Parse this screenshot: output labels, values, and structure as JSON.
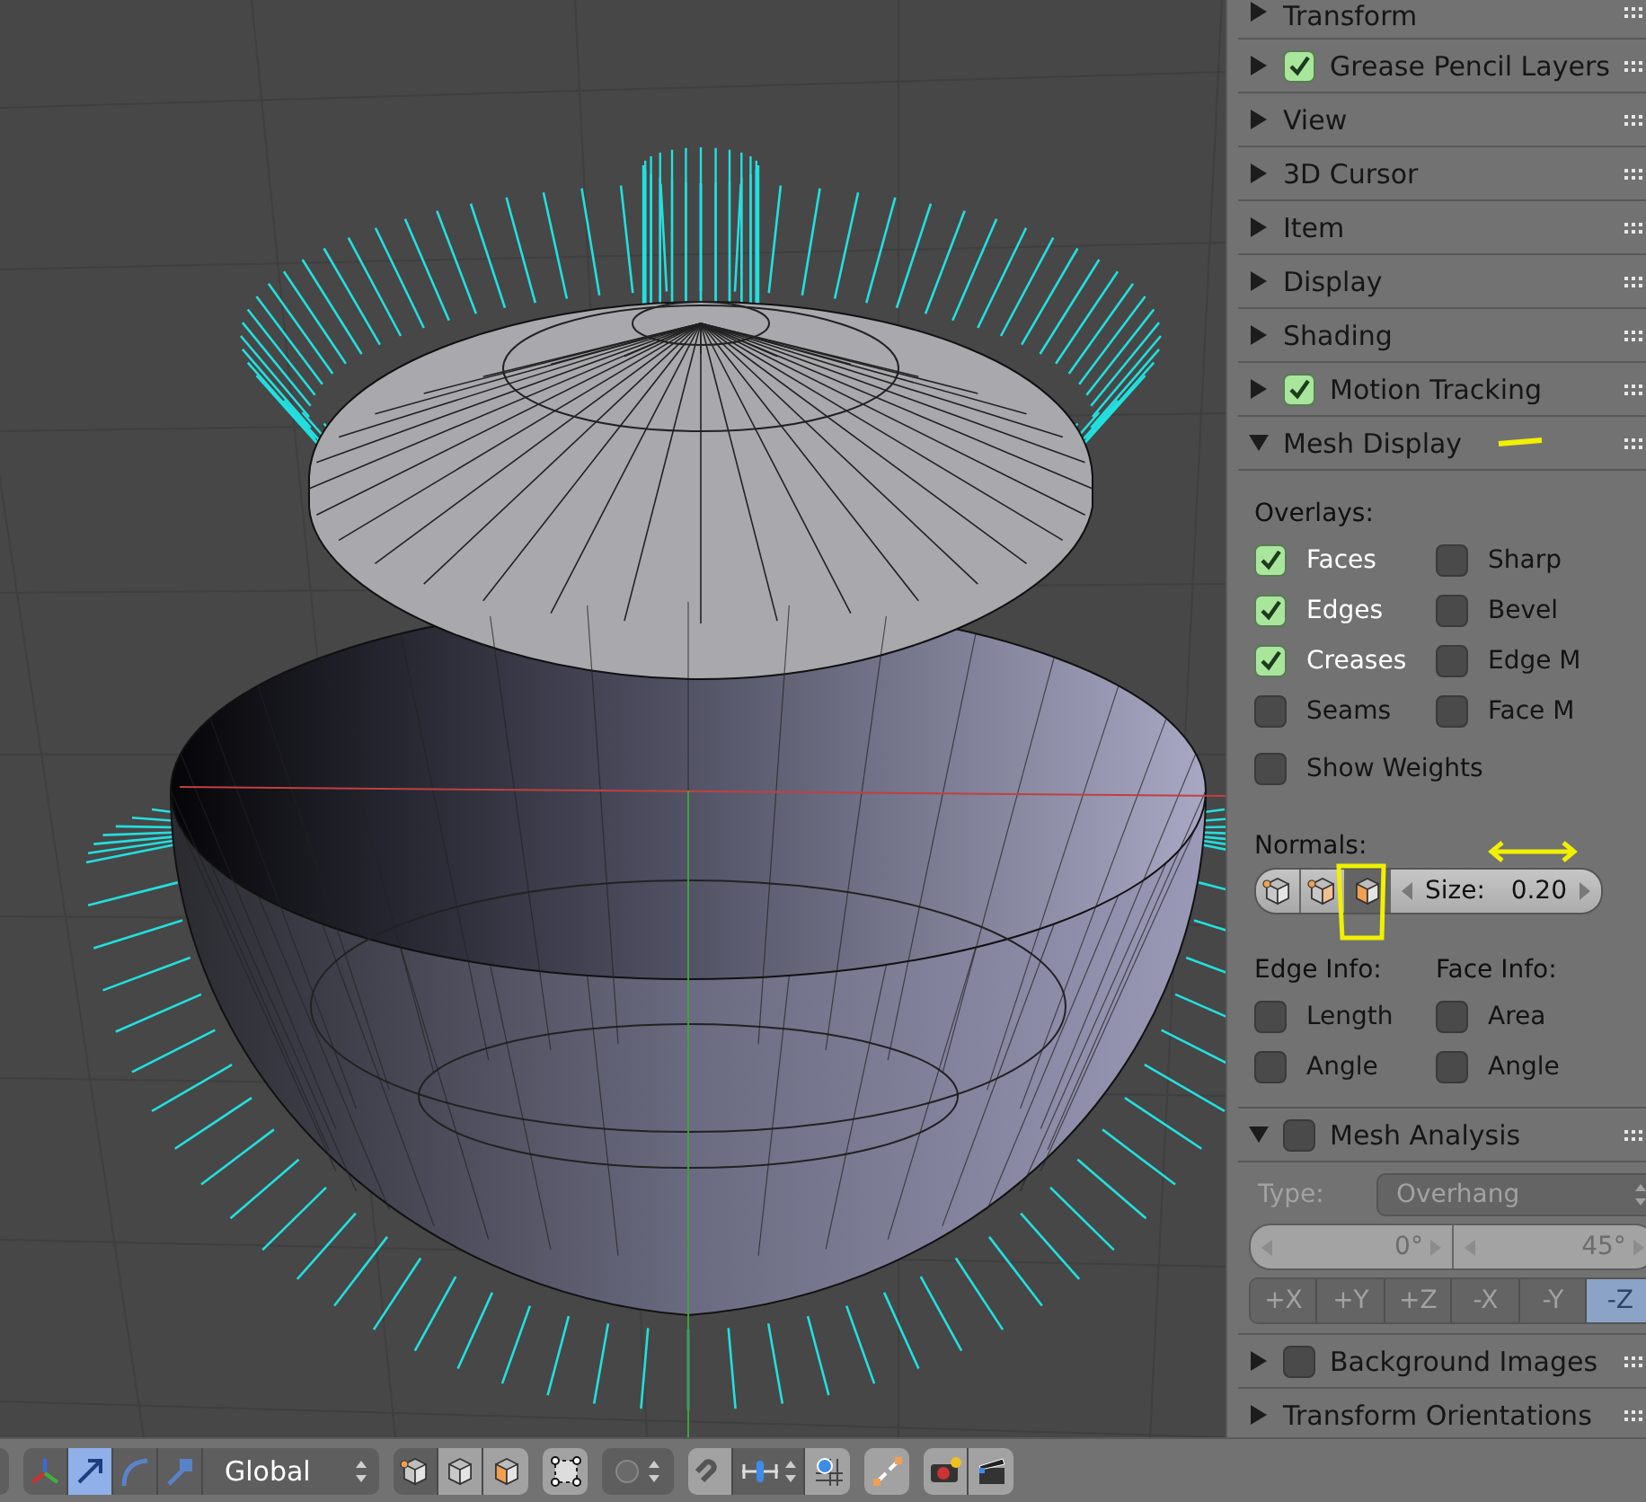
{
  "sidebar": {
    "panels": [
      {
        "kind": "plain",
        "title": "Transform",
        "expanded": false
      },
      {
        "kind": "toggle",
        "title": "Grease Pencil Layers",
        "expanded": false,
        "enabled": true
      },
      {
        "kind": "plain",
        "title": "View",
        "expanded": false
      },
      {
        "kind": "plain",
        "title": "3D Cursor",
        "expanded": false
      },
      {
        "kind": "plain",
        "title": "Item",
        "expanded": false
      },
      {
        "kind": "plain",
        "title": "Display",
        "expanded": false
      },
      {
        "kind": "plain",
        "title": "Shading",
        "expanded": false
      },
      {
        "kind": "toggle",
        "title": "Motion Tracking",
        "expanded": false,
        "enabled": true
      },
      {
        "kind": "mesh_display",
        "title": "Mesh Display",
        "expanded": true,
        "overlays_label": "Overlays:",
        "overlays": [
          {
            "label": "Faces",
            "checked": true
          },
          {
            "label": "Sharp",
            "checked": false
          },
          {
            "label": "Edges",
            "checked": true
          },
          {
            "label": "Bevel",
            "checked": false
          },
          {
            "label": "Creases",
            "checked": true
          },
          {
            "label": "Edge M",
            "checked": false
          },
          {
            "label": "Seams",
            "checked": false
          },
          {
            "label": "Face M",
            "checked": false
          }
        ],
        "show_weights": {
          "label": "Show Weights",
          "checked": false
        },
        "normals_label": "Normals:",
        "normal_modes": [
          {
            "kind": "vertex",
            "selected": false
          },
          {
            "kind": "split",
            "selected": false
          },
          {
            "kind": "face",
            "selected": true
          }
        ],
        "size": {
          "label": "Size:",
          "value": "0.20"
        },
        "edge_info": {
          "label": "Edge Info:",
          "items": [
            {
              "label": "Length",
              "checked": false
            },
            {
              "label": "Angle",
              "checked": false
            }
          ]
        },
        "face_info": {
          "label": "Face Info:",
          "items": [
            {
              "label": "Area",
              "checked": false
            },
            {
              "label": "Angle",
              "checked": false
            }
          ]
        }
      },
      {
        "kind": "mesh_analysis",
        "title": "Mesh Analysis",
        "expanded": true,
        "enabled": false,
        "type_label": "Type:",
        "type_value": "Overhang",
        "range": [
          "0°",
          "45°"
        ],
        "axes": [
          {
            "label": "+X",
            "selected": false
          },
          {
            "label": "+Y",
            "selected": false
          },
          {
            "label": "+Z",
            "selected": false
          },
          {
            "label": "-X",
            "selected": false
          },
          {
            "label": "-Y",
            "selected": false
          },
          {
            "label": "-Z",
            "selected": true
          }
        ]
      },
      {
        "kind": "toggle",
        "title": "Background Images",
        "expanded": false,
        "enabled": false
      },
      {
        "kind": "plain",
        "title": "Transform Orientations",
        "expanded": false
      }
    ]
  },
  "header": {
    "manipulators": [
      {
        "kind": "axes",
        "selected": false
      },
      {
        "kind": "translate",
        "selected": true
      },
      {
        "kind": "rotate",
        "selected": false
      },
      {
        "kind": "scale",
        "selected": false
      }
    ],
    "orientation": "Global",
    "select_modes": [
      {
        "kind": "vertex",
        "selected": true
      },
      {
        "kind": "edge",
        "selected": false
      },
      {
        "kind": "face",
        "selected": false
      }
    ]
  }
}
